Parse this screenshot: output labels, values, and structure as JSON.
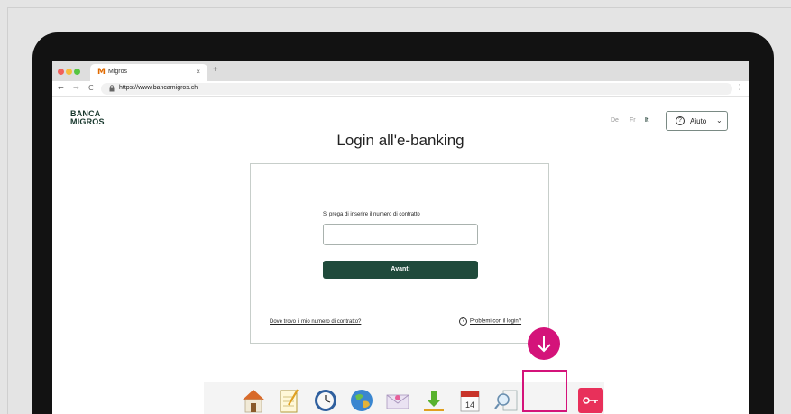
{
  "browser": {
    "tab_title": "Migros",
    "tab_favicon": "M",
    "tab_close": "×",
    "new_tab": "+",
    "url": "https://www.bancamigros.ch",
    "nav": {
      "back": "←",
      "forward": "→",
      "reload": "C",
      "lock": "🔒",
      "menu": "⋮"
    }
  },
  "page": {
    "logo_line1": "BANCA",
    "logo_line2": "MIGROS",
    "languages": [
      "De",
      "Fr",
      "It"
    ],
    "active_language": "It",
    "help_label": "Aiuto",
    "help_icon": "?",
    "help_chevron": "⌄",
    "title": "Login all'e-banking",
    "form": {
      "field_label": "Si prega di inserire il numero di contratto",
      "field_value": "",
      "submit_label": "Avanti",
      "link_contract": "Dove trovo il mio numero di contratto?",
      "link_problems": "Problemi con il login?",
      "problems_icon": "?"
    }
  },
  "dock": {
    "items": [
      "home-icon",
      "notes-icon",
      "clock-icon",
      "globe-icon",
      "mail-icon",
      "download-icon",
      "calendar-icon",
      "search-document-icon",
      "key-app-icon"
    ],
    "calendar_day": "14"
  },
  "overlay": {
    "accent_color": "#d4137a",
    "arrow_icon": "arrow-down-icon"
  }
}
